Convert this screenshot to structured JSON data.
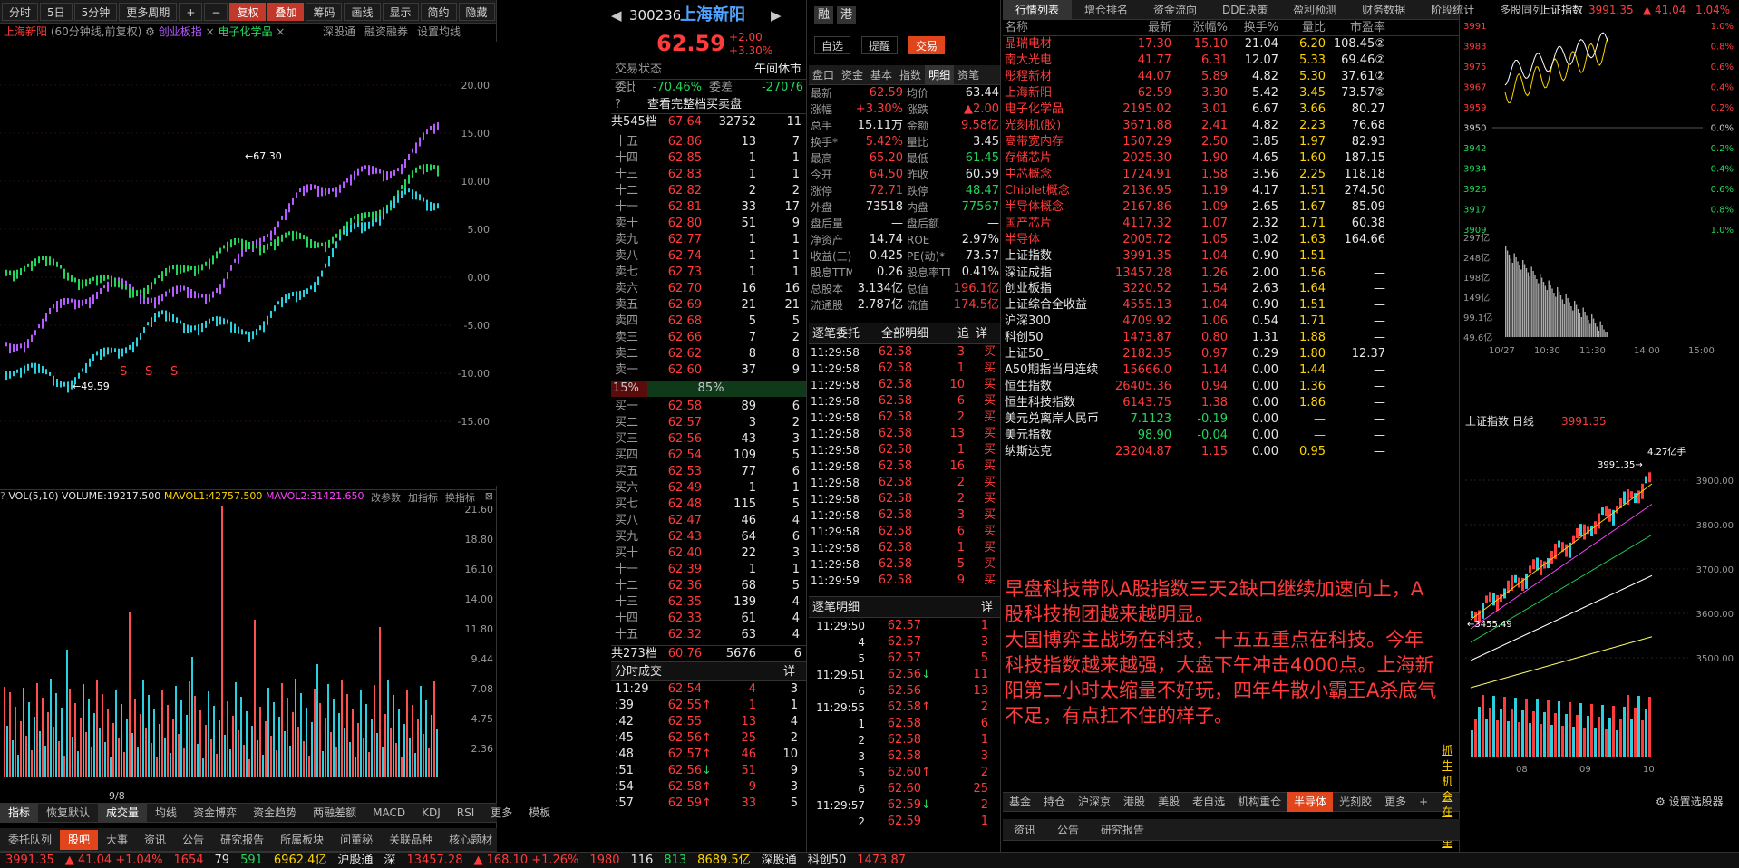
{
  "left": {
    "topbar": [
      "分时",
      "5日",
      "5分钟",
      "更多周期",
      "+",
      "−",
      "复权",
      "叠加",
      "筹码",
      "画线",
      "显示",
      "简约",
      "隐藏"
    ],
    "title": "上海新阳",
    "subtitle": "(60分钟线,前复权)",
    "overlay1": "创业板指",
    "overlay2": "电子化学品",
    "right_btns": [
      "深股通",
      "融资融券",
      "设置均线"
    ],
    "yaxis": [
      "20.00",
      "15.00",
      "10.00",
      "5.00",
      "0.00",
      "-5.00",
      "-10.00",
      "-15.00"
    ],
    "price_hi": "67.30",
    "price_lo": "49.59",
    "marks": [
      "S",
      "S",
      "S"
    ],
    "vol_legend": {
      "name": "VOL(5,10)",
      "volume": "VOLUME:19217.500",
      "mavol1": "MAVOL1:42757.500",
      "mavol2": "MAVOL2:31421.650",
      "btns": [
        "改参数",
        "加指标",
        "换指标"
      ]
    },
    "vol_axis": [
      "21.60",
      "18.80",
      "16.10",
      "14.00",
      "11.80",
      "9.44",
      "7.08",
      "4.75",
      "2.36"
    ],
    "date": "9/8",
    "tabs": [
      "指标",
      "恢复默认",
      "成交量",
      "均线",
      "资金博弈",
      "资金趋势",
      "两融差额",
      "MACD",
      "KDJ",
      "RSI",
      "更多",
      "模板"
    ],
    "bottom_tabs": [
      "委托队列",
      "股吧",
      "大事",
      "资讯",
      "公告",
      "研究报告",
      "所属板块",
      "问董秘",
      "关联品种",
      "核心题材"
    ]
  },
  "quote": {
    "code": "300236",
    "name": "上海新阳",
    "price": "62.59",
    "chg": "+2.00",
    "pct": "+3.30%",
    "badges": [
      "融",
      "港"
    ],
    "btns": [
      "自选",
      "提醒",
      "交易"
    ],
    "status_label": "交易状态",
    "status": "午间休市",
    "wb_label": "委比",
    "wb": "-70.46%",
    "wc_label": "委差",
    "wc": "-27076",
    "full_btn": "查看完整档买卖盘",
    "sell_total": [
      "共545档",
      "67.64",
      "32752",
      "11"
    ],
    "sells": [
      [
        "十五",
        "62.86",
        "13",
        "7"
      ],
      [
        "十四",
        "62.85",
        "1",
        "1"
      ],
      [
        "十三",
        "62.83",
        "1",
        "1"
      ],
      [
        "十二",
        "62.82",
        "2",
        "2"
      ],
      [
        "十一",
        "62.81",
        "33",
        "17"
      ],
      [
        "卖十",
        "62.80",
        "51",
        "9"
      ],
      [
        "卖九",
        "62.77",
        "1",
        "1"
      ],
      [
        "卖八",
        "62.74",
        "1",
        "1"
      ],
      [
        "卖七",
        "62.73",
        "1",
        "1"
      ],
      [
        "卖六",
        "62.70",
        "16",
        "16"
      ],
      [
        "卖五",
        "62.69",
        "21",
        "21"
      ],
      [
        "卖四",
        "62.68",
        "5",
        "5"
      ],
      [
        "卖三",
        "62.66",
        "7",
        "2"
      ],
      [
        "卖二",
        "62.62",
        "8",
        "8"
      ],
      [
        "卖一",
        "62.60",
        "37",
        "9"
      ]
    ],
    "ratio": [
      "15%",
      "85%"
    ],
    "buys": [
      [
        "买一",
        "62.58",
        "89",
        "6"
      ],
      [
        "买二",
        "62.57",
        "3",
        "2"
      ],
      [
        "买三",
        "62.56",
        "43",
        "3"
      ],
      [
        "买四",
        "62.54",
        "109",
        "5"
      ],
      [
        "买五",
        "62.53",
        "77",
        "6"
      ],
      [
        "买六",
        "62.49",
        "1",
        "1"
      ],
      [
        "买七",
        "62.48",
        "115",
        "5"
      ],
      [
        "买八",
        "62.47",
        "46",
        "4"
      ],
      [
        "买九",
        "62.43",
        "64",
        "6"
      ],
      [
        "买十",
        "62.40",
        "22",
        "3"
      ],
      [
        "十一",
        "62.39",
        "1",
        "1"
      ],
      [
        "十二",
        "62.36",
        "68",
        "5"
      ],
      [
        "十三",
        "62.35",
        "139",
        "4"
      ],
      [
        "十四",
        "62.33",
        "61",
        "4"
      ],
      [
        "十五",
        "62.32",
        "63",
        "4"
      ]
    ],
    "buy_total": [
      "共273档",
      "60.76",
      "5676",
      "6"
    ],
    "ticks_title": "分时成交",
    "ticks_btn": "详",
    "ticks": [
      [
        "11:29",
        "62.54",
        "",
        "4",
        "3"
      ],
      [
        ":39",
        "62.55",
        "↑",
        "1",
        "1"
      ],
      [
        ":42",
        "62.55",
        "",
        "13",
        "4"
      ],
      [
        ":45",
        "62.56",
        "↑",
        "25",
        "2"
      ],
      [
        ":48",
        "62.57",
        "↑",
        "46",
        "10"
      ],
      [
        ":51",
        "62.56",
        "↓",
        "51",
        "9"
      ],
      [
        ":54",
        "62.58",
        "↑",
        "9",
        "3"
      ],
      [
        ":57",
        "62.59",
        "↑",
        "33",
        "5"
      ]
    ]
  },
  "detail": {
    "tabs": [
      "盘口",
      "资金",
      "基本",
      "指数",
      "明细",
      "资笔"
    ],
    "rows": [
      [
        "最新",
        "62.59",
        "均价",
        "63.44"
      ],
      [
        "涨幅",
        "+3.30%",
        "涨跌",
        "▲2.00"
      ],
      [
        "总手",
        "15.11万",
        "金额",
        "9.58亿"
      ],
      [
        "换手*",
        "5.42%",
        "量比",
        "3.45"
      ],
      [
        "最高",
        "65.20",
        "最低",
        "61.45"
      ],
      [
        "今开",
        "64.50",
        "昨收",
        "60.59"
      ],
      [
        "涨停",
        "72.71",
        "跌停",
        "48.47"
      ],
      [
        "外盘",
        "73518",
        "内盘",
        "77567"
      ],
      [
        "盘后量",
        "—",
        "盘后额",
        "—"
      ],
      [
        "净资产",
        "14.74",
        "ROE",
        "2.97%"
      ],
      [
        "收益(三)",
        "0.425",
        "PE(动)*",
        "73.57"
      ],
      [
        "股息TTM",
        "0.26",
        "股息率TTM",
        "0.41%"
      ],
      [
        "总股本",
        "3.134亿",
        "总值",
        "196.1亿"
      ],
      [
        "流通股",
        "2.787亿",
        "流值",
        "174.5亿"
      ]
    ],
    "zhubi_title": "逐笔委托",
    "zhubi_filter": "全部明细",
    "zhubi_btns": [
      "追",
      "详"
    ],
    "zhubi": [
      [
        "11:29:58",
        "62.58",
        "3",
        "买"
      ],
      [
        "11:29:58",
        "62.58",
        "1",
        "买"
      ],
      [
        "11:29:58",
        "62.58",
        "10",
        "买"
      ],
      [
        "11:29:58",
        "62.58",
        "6",
        "买"
      ],
      [
        "11:29:58",
        "62.58",
        "2",
        "买"
      ],
      [
        "11:29:58",
        "62.58",
        "13",
        "买"
      ],
      [
        "11:29:58",
        "62.58",
        "1",
        "买"
      ],
      [
        "11:29:58",
        "62.58",
        "16",
        "买"
      ],
      [
        "11:29:58",
        "62.58",
        "2",
        "买"
      ],
      [
        "11:29:58",
        "62.58",
        "2",
        "买"
      ],
      [
        "11:29:58",
        "62.58",
        "3",
        "买"
      ],
      [
        "11:29:58",
        "62.58",
        "6",
        "买"
      ],
      [
        "11:29:58",
        "62.58",
        "1",
        "买"
      ],
      [
        "11:29:58",
        "62.58",
        "5",
        "买"
      ],
      [
        "11:29:59",
        "62.58",
        "9",
        "买"
      ]
    ],
    "mx_title": "逐笔明细",
    "mx_btn": "详",
    "mx": [
      [
        "11:29:50",
        "62.57",
        "",
        "1"
      ],
      [
        "4",
        "62.57",
        "",
        "3"
      ],
      [
        "5",
        "62.57",
        "",
        "5"
      ],
      [
        "11:29:51",
        "62.56",
        "↓",
        "11"
      ],
      [
        "6",
        "62.56",
        "",
        "13"
      ],
      [
        "11:29:55",
        "62.58",
        "↑",
        "2"
      ],
      [
        "1",
        "62.58",
        "",
        "6"
      ],
      [
        "2",
        "62.58",
        "",
        "1"
      ],
      [
        "3",
        "62.58",
        "",
        "3"
      ],
      [
        "5",
        "62.60",
        "↑",
        "2"
      ],
      [
        "6",
        "62.60",
        "",
        "25"
      ],
      [
        "11:29:57",
        "62.59",
        "↓",
        "2"
      ],
      [
        "2",
        "62.59",
        "",
        "1"
      ]
    ]
  },
  "list": {
    "tabs": [
      "行情列表",
      "增仓排名",
      "资金流向",
      "DDE决策",
      "盈利预测",
      "财务数据",
      "阶段统计",
      "多股同列"
    ],
    "headers": [
      "名称",
      "最新",
      "涨幅%",
      "换手%",
      "量比",
      "市盈率"
    ],
    "rows": [
      [
        "晶瑞电材",
        "17.30",
        "15.10",
        "21.04",
        "6.20",
        "108.45②"
      ],
      [
        "南大光电",
        "41.77",
        "6.31",
        "12.07",
        "5.33",
        "69.46②"
      ],
      [
        "彤程新材",
        "44.07",
        "5.89",
        "4.82",
        "5.30",
        "37.61②"
      ],
      [
        "上海新阳",
        "62.59",
        "3.30",
        "5.42",
        "3.45",
        "73.57②"
      ],
      [
        "电子化学品",
        "2195.02",
        "3.01",
        "6.67",
        "3.66",
        "80.27"
      ],
      [
        "光刻机(胶)",
        "3671.88",
        "2.41",
        "4.82",
        "2.23",
        "76.68"
      ],
      [
        "高带宽内存",
        "1507.29",
        "2.50",
        "3.85",
        "1.97",
        "82.93"
      ],
      [
        "存储芯片",
        "2025.30",
        "1.90",
        "4.65",
        "1.60",
        "187.15"
      ],
      [
        "中芯概念",
        "1724.91",
        "1.58",
        "3.56",
        "2.25",
        "118.18"
      ],
      [
        "Chiplet概念",
        "2136.95",
        "1.19",
        "4.17",
        "1.51",
        "274.50"
      ],
      [
        "半导体概念",
        "2167.86",
        "1.09",
        "2.65",
        "1.67",
        "85.09"
      ],
      [
        "国产芯片",
        "4117.32",
        "1.07",
        "2.32",
        "1.71",
        "60.38"
      ],
      [
        "半导体",
        "2005.72",
        "1.05",
        "3.02",
        "1.63",
        "164.66"
      ],
      [
        "上证指数",
        "3991.35",
        "1.04",
        "0.90",
        "1.51",
        "—"
      ],
      [
        "深证成指",
        "13457.28",
        "1.26",
        "2.00",
        "1.56",
        "—"
      ],
      [
        "创业板指",
        "3220.52",
        "1.54",
        "2.63",
        "1.64",
        "—"
      ],
      [
        "上证综合全收益",
        "4555.13",
        "1.04",
        "0.90",
        "1.51",
        "—"
      ],
      [
        "沪深300",
        "4709.92",
        "1.06",
        "0.54",
        "1.71",
        "—"
      ],
      [
        "科创50",
        "1473.87",
        "0.80",
        "1.31",
        "1.88",
        "—"
      ],
      [
        "上证50_",
        "2182.35",
        "0.97",
        "0.29",
        "1.80",
        "12.37"
      ],
      [
        "A50期指当月连续",
        "15666.0",
        "1.14",
        "0.00",
        "1.44",
        "—"
      ],
      [
        "恒生指数",
        "26405.36",
        "0.94",
        "0.00",
        "1.36",
        "—"
      ],
      [
        "恒生科技指数",
        "6143.75",
        "1.38",
        "0.00",
        "1.86",
        "—"
      ],
      [
        "美元兑离岸人民币",
        "7.1123",
        "-0.19",
        "0.00",
        "—",
        "—"
      ],
      [
        "美元指数",
        "98.90",
        "-0.04",
        "0.00",
        "—",
        "—"
      ],
      [
        "纳斯达克",
        "23204.87",
        "1.15",
        "0.00",
        "0.95",
        "—"
      ]
    ],
    "note": "早盘科技带队A股指数三天2缺口继续加速向上，A股科技抱团越来越明显。\n大国博弈主战场在科技，十五五重点在科技。今年科技指数越来越强，大盘下午冲击4000点。上海新阳第二小时太缩量不好玩，四年牛散小霸王A杀底气不足，有点扛不住的样子。",
    "bottom_tabs": [
      "基金",
      "持仓",
      "沪深京",
      "港股",
      "美股",
      "老自选",
      "机构重仓",
      "半导体",
      "光刻胶",
      "更多",
      "+"
    ],
    "link": "抓牛机会在这里>>",
    "settings": "设置选股器",
    "sub_tabs": [
      "资讯",
      "公告",
      "研究报告"
    ]
  },
  "index": {
    "name": "上证指数",
    "price": "3991.35",
    "chg": "▲ 41.04",
    "pct": "1.04%",
    "yl": [
      "3991",
      "3983",
      "3975",
      "3967",
      "3959",
      "3950",
      "3942",
      "3934",
      "3926",
      "3917",
      "3909"
    ],
    "yr": [
      "1.0%",
      "0.8%",
      "0.6%",
      "0.4%",
      "0.2%",
      "0.0%",
      "0.2%",
      "0.4%",
      "0.6%",
      "0.8%",
      "1.0%"
    ],
    "vl": [
      "297亿",
      "248亿",
      "198亿",
      "149亿",
      "99.1亿",
      "49.6亿"
    ],
    "times": [
      "10/27",
      "10:30",
      "11:30",
      "14:00",
      "15:00"
    ],
    "k_title": "上证指数 日线",
    "k_price": "3991.35",
    "k_vol": "4.27亿手",
    "k_hi": "3991.35",
    "k_lo": "3455.49",
    "k_axis": [
      "3900.00",
      "3800.00",
      "3700.00",
      "3600.00",
      "3500.00"
    ],
    "k_months": [
      "08",
      "09",
      "10"
    ]
  },
  "status": {
    "items": [
      [
        "3991.35",
        "▲ 41.04 +1.04%",
        "1654",
        "79",
        "591",
        "6962.4亿"
      ],
      [
        "沪股通"
      ],
      [
        "深",
        "13457.28",
        "▲ 168.10 +1.26%",
        "1980",
        "116",
        "813",
        "8689.5亿"
      ],
      [
        "深股通"
      ],
      [
        "科创50",
        "1473.87"
      ]
    ]
  }
}
